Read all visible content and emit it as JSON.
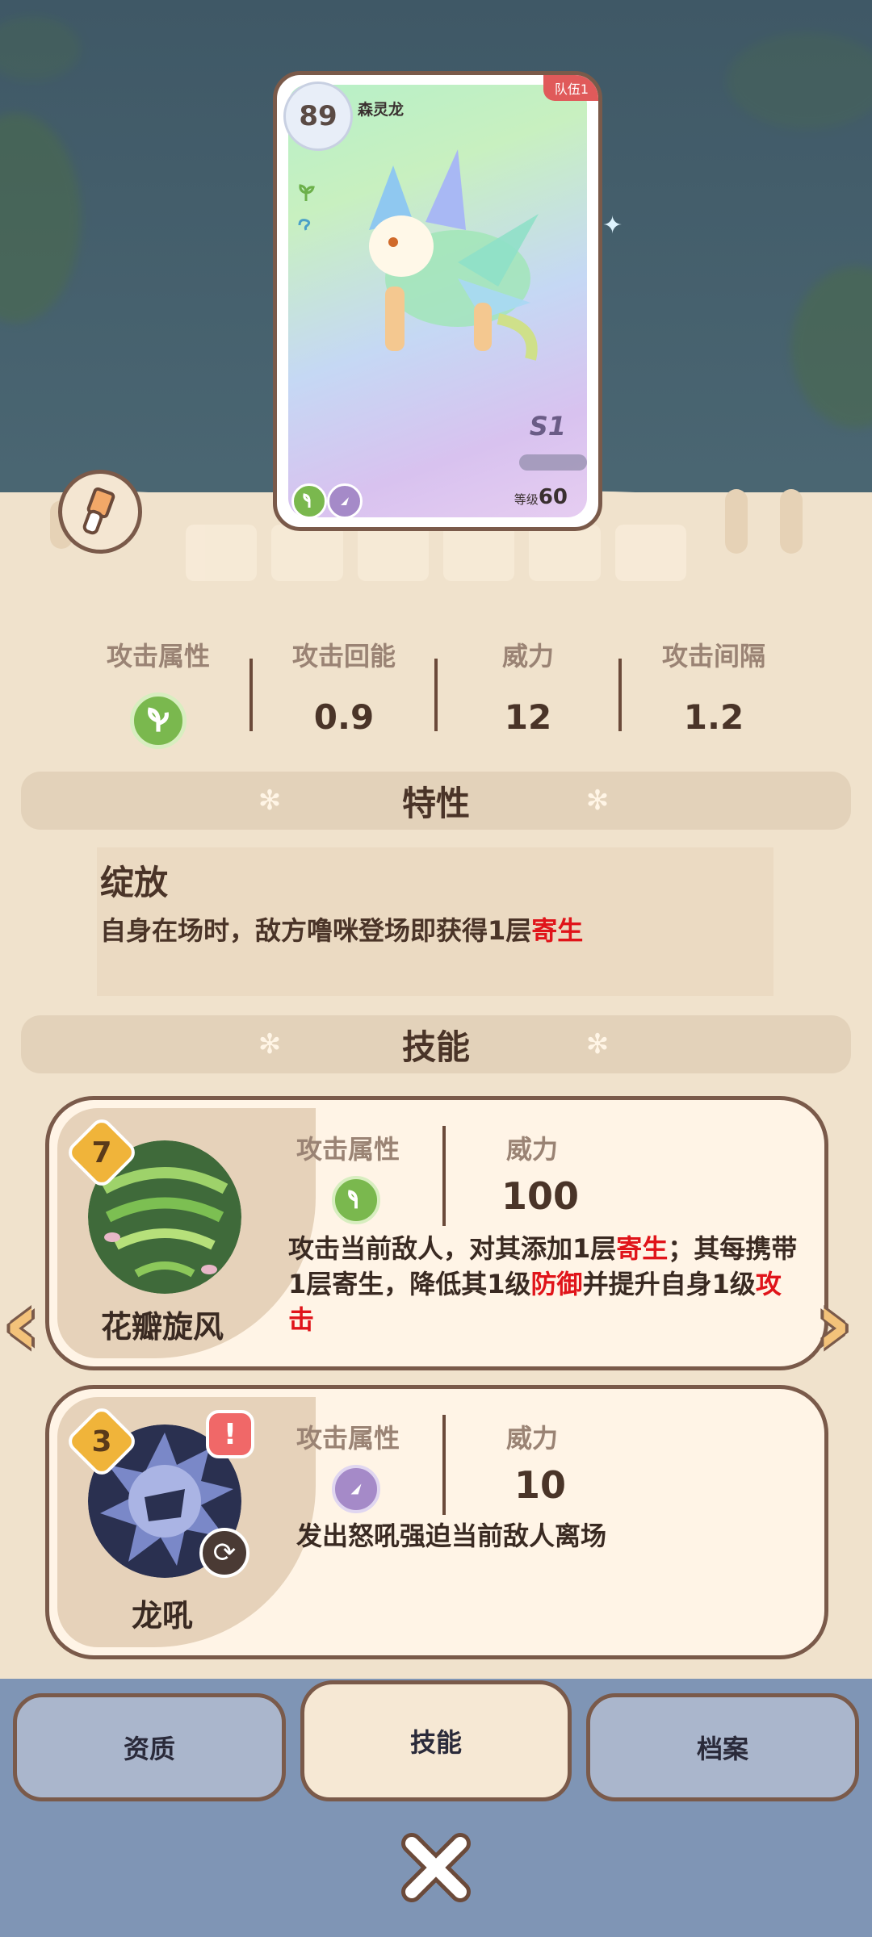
{
  "card": {
    "level": "89",
    "name": "森灵龙",
    "team": "队伍1",
    "rank": "S1",
    "level_label": "等级",
    "level_value": "60"
  },
  "stats": [
    {
      "label": "攻击属性",
      "value": "",
      "icon": "grass-element-icon"
    },
    {
      "label": "攻击回能",
      "value": "0.9"
    },
    {
      "label": "威力",
      "value": "12"
    },
    {
      "label": "攻击间隔",
      "value": "1.2"
    }
  ],
  "trait_section": {
    "title": "特性"
  },
  "trait": {
    "name": "绽放",
    "desc_prefix": "自身在场时，敌方噜咪登场即获得1层",
    "desc_highlight": "寄生"
  },
  "skill_section": {
    "title": "技能"
  },
  "skills": [
    {
      "name": "花瓣旋风",
      "cost": "7",
      "attr_label": "攻击属性",
      "power_label": "威力",
      "power": "100",
      "desc": [
        {
          "t": "攻击当前敌人，对其添加1层",
          "red": false
        },
        {
          "t": "寄生",
          "red": true
        },
        {
          "t": "；其每携带1层寄生，降低其1级",
          "red": false
        },
        {
          "t": "防御",
          "red": true
        },
        {
          "t": "并提升自身1级",
          "red": false
        },
        {
          "t": "攻击",
          "red": true
        }
      ]
    },
    {
      "name": "龙吼",
      "cost": "3",
      "attr_label": "攻击属性",
      "power_label": "威力",
      "power": "10",
      "desc_text": "发出怒吼强迫当前敌人离场"
    }
  ],
  "tabs": {
    "aptitude": "资质",
    "skills": "技能",
    "profile": "档案"
  },
  "colors": {
    "accent_red": "#e0141a",
    "panel": "#f0e2cc",
    "bottom": "#7f95b5"
  }
}
